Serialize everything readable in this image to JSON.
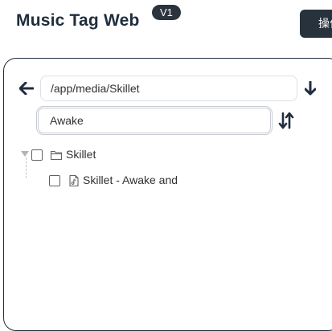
{
  "header": {
    "title": "Music Tag Web",
    "version": "V1",
    "ops_label": "操作"
  },
  "browser": {
    "path_value": "/app/media/Skillet",
    "filter_value": "Awake"
  },
  "tree": {
    "folder": {
      "label": "Skillet",
      "checked": false,
      "expanded": true
    },
    "files": [
      {
        "label": "Skillet - Awake and",
        "checked": false
      }
    ]
  },
  "icons": {
    "back": "arrow-left-icon",
    "download": "arrow-down-icon",
    "sort": "sort-icon",
    "folder": "folder-icon",
    "file": "audio-file-icon",
    "caret": "caret-down-icon"
  },
  "colors": {
    "dark": "#1f2d3d",
    "badge": "#2b333c",
    "border": "#dcdfe6"
  }
}
